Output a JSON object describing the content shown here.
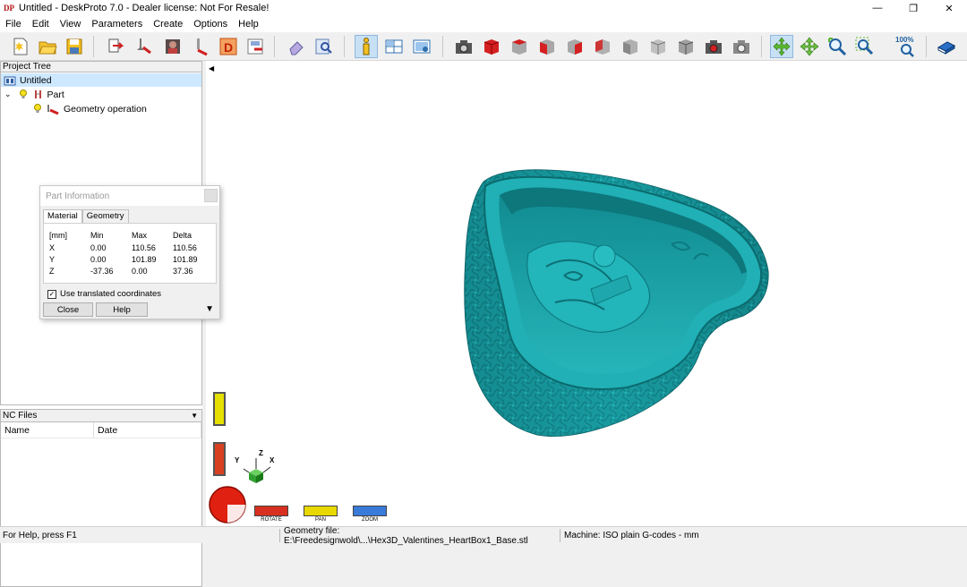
{
  "window": {
    "icon_text": "DP",
    "title": "Untitled - DeskProto 7.0 - Dealer license: Not For Resale!",
    "minimize": "—",
    "restore": "❐",
    "close": "✕"
  },
  "menu": [
    "File",
    "Edit",
    "View",
    "Parameters",
    "Create",
    "Options",
    "Help"
  ],
  "toolbar": {
    "zoom_percent": "100%"
  },
  "project_tree": {
    "header": "Project Tree",
    "items": [
      {
        "label": "Untitled"
      },
      {
        "label": "Part"
      },
      {
        "label": "Geometry operation"
      }
    ]
  },
  "nc_files": {
    "header": "NC Files",
    "columns": [
      "Name",
      "Date"
    ]
  },
  "part_info": {
    "title": "Part Information",
    "tabs": [
      "Material",
      "Geometry"
    ],
    "headers": [
      "[mm]",
      "Min",
      "Max",
      "Delta"
    ],
    "rows": [
      {
        "axis": "X",
        "min": "0.00",
        "max": "110.56",
        "delta": "110.56"
      },
      {
        "axis": "Y",
        "min": "0.00",
        "max": "101.89",
        "delta": "101.89"
      },
      {
        "axis": "Z",
        "min": "-37.36",
        "max": "0.00",
        "delta": "37.36"
      }
    ],
    "checkbox_label": "Use translated coordinates",
    "checkbox_checked": true,
    "close_label": "Close",
    "help_label": "Help"
  },
  "viewport": {
    "model_color": "#1aa3a8",
    "background": "#ffffff",
    "axes": {
      "x": "X",
      "y": "Y",
      "z": "Z"
    },
    "nav_buttons": {
      "rotate": "ROTATE",
      "pan": "PAN",
      "zoom": "ZOOM"
    }
  },
  "status": {
    "help": "For Help, press F1",
    "geometry_file": "Geometry file: E:\\Freedesignwold\\...\\Hex3D_Valentines_HeartBox1_Base.stl",
    "machine": "Machine: ISO plain G-codes - mm"
  }
}
